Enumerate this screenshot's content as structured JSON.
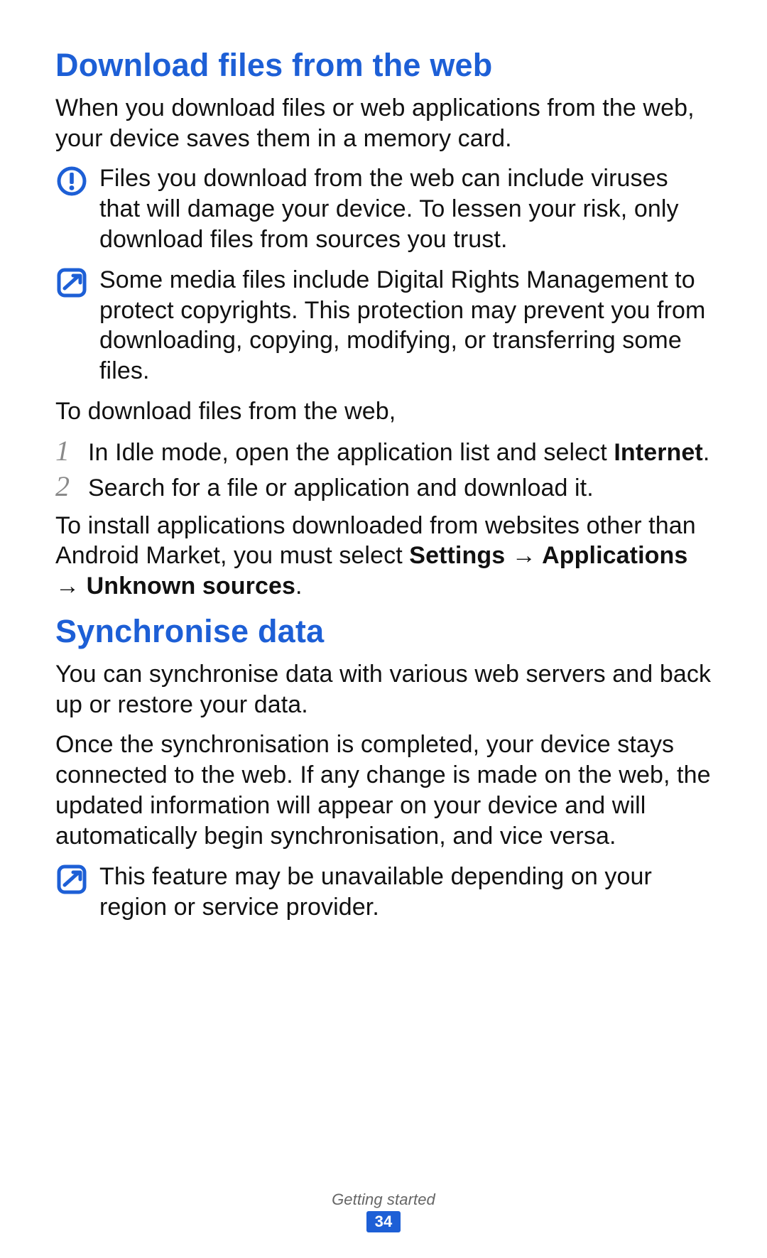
{
  "section1": {
    "heading": "Download files from the web",
    "intro": "When you download files or web applications from the web, your device saves them in a memory card.",
    "warning": "Files you download from the web can include viruses that will damage your device. To lessen your risk, only download files from sources you trust.",
    "note": "Some media files include Digital Rights Management to protect copyrights. This protection may prevent you from downloading, copying, modifying, or transferring some files.",
    "lead": "To download files from the web,",
    "steps": [
      {
        "num": "1",
        "pre": "In Idle mode, open the application list and select ",
        "bold": "Internet",
        "post": "."
      },
      {
        "num": "2",
        "pre": "Search for a file or application and download it.",
        "bold": "",
        "post": ""
      }
    ],
    "afterSteps_pre": "To install applications downloaded from websites other than Android Market, you must select ",
    "afterSteps_bold": "Settings → Applications → Unknown sources",
    "afterSteps_post": "."
  },
  "section2": {
    "heading": "Synchronise data",
    "p1": "You can synchronise data with various web servers and back up or restore your data.",
    "p2": "Once the synchronisation is completed, your device stays connected to the web. If any change is made on the web, the updated information will appear on your device and will automatically begin synchronisation, and vice versa.",
    "note": "This feature may be unavailable depending on your region or service provider."
  },
  "footer": {
    "title": "Getting started",
    "page": "34"
  }
}
